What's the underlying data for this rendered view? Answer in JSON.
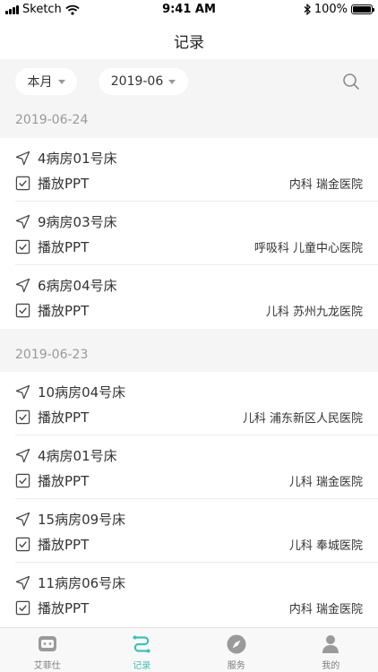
{
  "status_bar": {
    "carrier": "Sketch",
    "time": "9:41 AM",
    "battery": "100%"
  },
  "nav": {
    "title": "记录"
  },
  "filters": {
    "period_label": "本月",
    "date_label": "2019-06"
  },
  "sections": [
    {
      "date": "2019-06-24",
      "records": [
        {
          "room": "4病房01号床",
          "action": "播放PPT",
          "dept": "内科",
          "hospital": "瑞金医院"
        },
        {
          "room": "9病房03号床",
          "action": "播放PPT",
          "dept": "呼吸科",
          "hospital": "儿童中心医院"
        },
        {
          "room": "6病房04号床",
          "action": "播放PPT",
          "dept": "儿科",
          "hospital": "苏州九龙医院"
        }
      ]
    },
    {
      "date": "2019-06-23",
      "records": [
        {
          "room": "10病房04号床",
          "action": "播放PPT",
          "dept": "儿科",
          "hospital": "浦东新区人民医院"
        },
        {
          "room": "4病房01号床",
          "action": "播放PPT",
          "dept": "儿科",
          "hospital": "瑞金医院"
        },
        {
          "room": "15病房09号床",
          "action": "播放PPT",
          "dept": "儿科",
          "hospital": "奉城医院"
        },
        {
          "room": "11病房06号床",
          "action": "播放PPT",
          "dept": "内科",
          "hospital": "瑞金医院"
        }
      ]
    }
  ],
  "tabs": [
    {
      "label": "艾菲仕",
      "icon": "robot-icon",
      "active": false
    },
    {
      "label": "记录",
      "icon": "route-icon",
      "active": true
    },
    {
      "label": "服务",
      "icon": "compass-icon",
      "active": false
    },
    {
      "label": "我的",
      "icon": "user-icon",
      "active": false
    }
  ],
  "colors": {
    "accent": "#3fc1b3",
    "section_bg": "#f5f5f5",
    "muted_text": "#999999"
  }
}
